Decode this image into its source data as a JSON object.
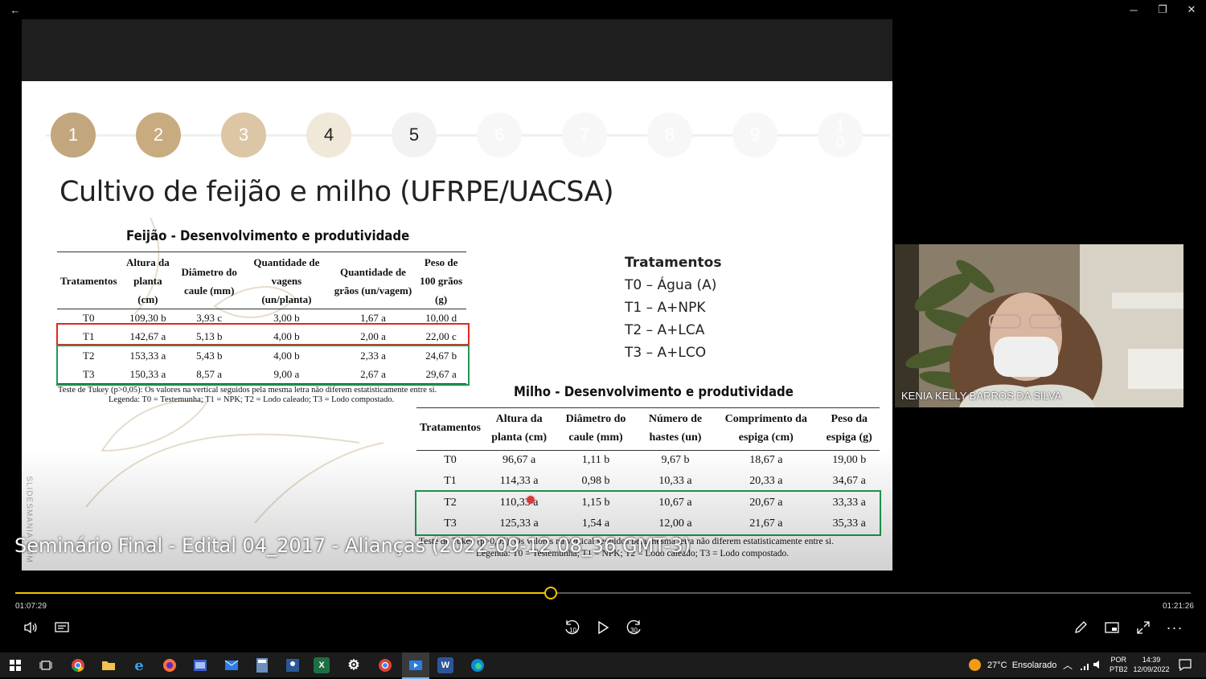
{
  "window": {
    "back_label": "←",
    "minimize_label": "─",
    "restore_label": "❐",
    "close_label": "✕"
  },
  "slide": {
    "steps": [
      "1",
      "2",
      "3",
      "4",
      "5",
      "6",
      "7",
      "8",
      "9",
      "1\n0"
    ],
    "title": "Cultivo de feijão e milho (UFRPE/UACSA)",
    "feijao": {
      "title": "Feijão - Desenvolvimento e produtividade",
      "headers": [
        "Tratamentos",
        "Altura da planta (cm)",
        "Diâmetro do caule (mm)",
        "Quantidade de vagens (un/planta)",
        "Quantidade de grãos (un/vagem)",
        "Peso de 100 grãos (g)"
      ],
      "rows": [
        [
          "T0",
          "109,30 b",
          "3,93 c",
          "3,00 b",
          "1,67 a",
          "10,00 d"
        ],
        [
          "T1",
          "142,67 a",
          "5,13 b",
          "4,00 b",
          "2,00 a",
          "22,00 c"
        ],
        [
          "T2",
          "153,33 a",
          "5,43 b",
          "4,00 b",
          "2,33 a",
          "24,67 b"
        ],
        [
          "T3",
          "150,33 a",
          "8,57 a",
          "9,00 a",
          "2,67 a",
          "29,67 a"
        ]
      ],
      "note1": "Teste de Tukey (p>0,05): Os valores na vertical seguidos pela mesma letra não diferem estatisticamente entre si.",
      "note2": "Legenda: T0 = Testemunha; T1 = NPK; T2 = Lodo caleado; T3 = Lodo compostado."
    },
    "treatments": {
      "title": "Tratamentos",
      "items": [
        "T0 – Água (A)",
        "T1 – A+NPK",
        "T2 – A+LCA",
        "T3 – A+LCO"
      ]
    },
    "milho": {
      "title": "Milho - Desenvolvimento e produtividade",
      "headers": [
        "Tratamentos",
        "Altura da planta (cm)",
        "Diâmetro do caule (mm)",
        "Número de hastes (un)",
        "Comprimento da espiga (cm)",
        "Peso da espiga (g)"
      ],
      "rows": [
        [
          "T0",
          "96,67 a",
          "1,11 b",
          "9,67 b",
          "18,67 a",
          "19,00 b"
        ],
        [
          "T1",
          "114,33 a",
          "0,98 b",
          "10,33 a",
          "20,33 a",
          "34,67 a"
        ],
        [
          "T2",
          "110,33 a",
          "1,15 b",
          "10,67 a",
          "20,67 a",
          "33,33 a"
        ],
        [
          "T3",
          "125,33 a",
          "1,54 a",
          "12,00 a",
          "21,67 a",
          "35,33 a"
        ]
      ],
      "note1": "Teste de Tukey (p>0,05): Os valores na vertical seguidos pela mesma letra não diferem estatisticamente entre si.",
      "note2": "Legenda: T0 = Testemunha; T1 = NPK; T2 = Lodo caleado; T3 = Lodo compostado."
    },
    "watermark": "SLIDESMANIA.COM"
  },
  "video": {
    "caption": "Seminário Final - Edital 04_2017 - Alianças  (2022-09-12 08_36 GMT-3)",
    "elapsed": "01:07:29",
    "duration": "01:21:26",
    "progress": 0.455
  },
  "participant": {
    "name": "KENIA KELLY BARROS DA SILVA"
  },
  "controls": {
    "rewind_label": "10",
    "forward_label": "30"
  },
  "colors": {
    "accent": "#f5c400",
    "red_box": "#e0281e",
    "green_box": "#1f9a55",
    "step_dark": "#c2a67d"
  },
  "taskbar": {
    "weather": "27°C  Ensolarado",
    "language": "POR",
    "layout": "PTB2",
    "time": "14:39",
    "date": "12/09/2022"
  }
}
